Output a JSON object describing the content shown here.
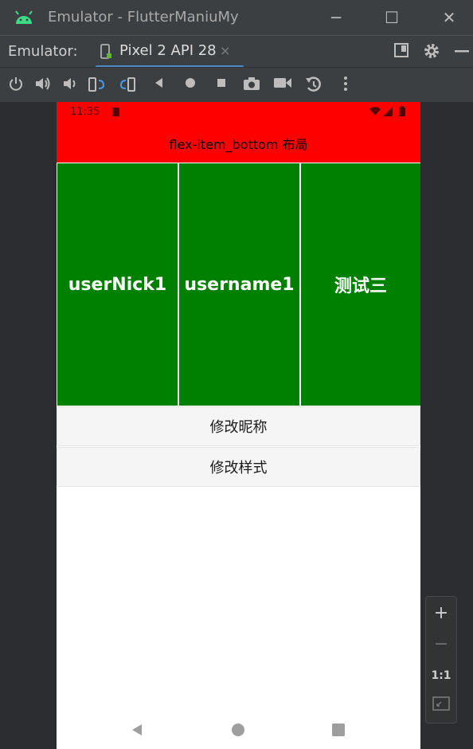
{
  "window": {
    "title": "Emulator - FlutterManiuMy",
    "minimize": "─",
    "maximize": "☐",
    "close": "✕"
  },
  "tabs": {
    "label": "Emulator:",
    "device_tab": "Pixel 2 API 28",
    "close": "×"
  },
  "phone": {
    "status_time": "11:35",
    "app_title": "flex-item_bottom 布局",
    "items": [
      "userNick1",
      "username1",
      "测试三"
    ],
    "buttons": [
      "修改昵称",
      "修改样式"
    ]
  },
  "zoom": {
    "plus": "+",
    "minus": "−",
    "one_to_one": "1:1"
  },
  "colors": {
    "appbar": "#ff0000",
    "item_bg": "#008000",
    "accent": "#4a88c7"
  }
}
